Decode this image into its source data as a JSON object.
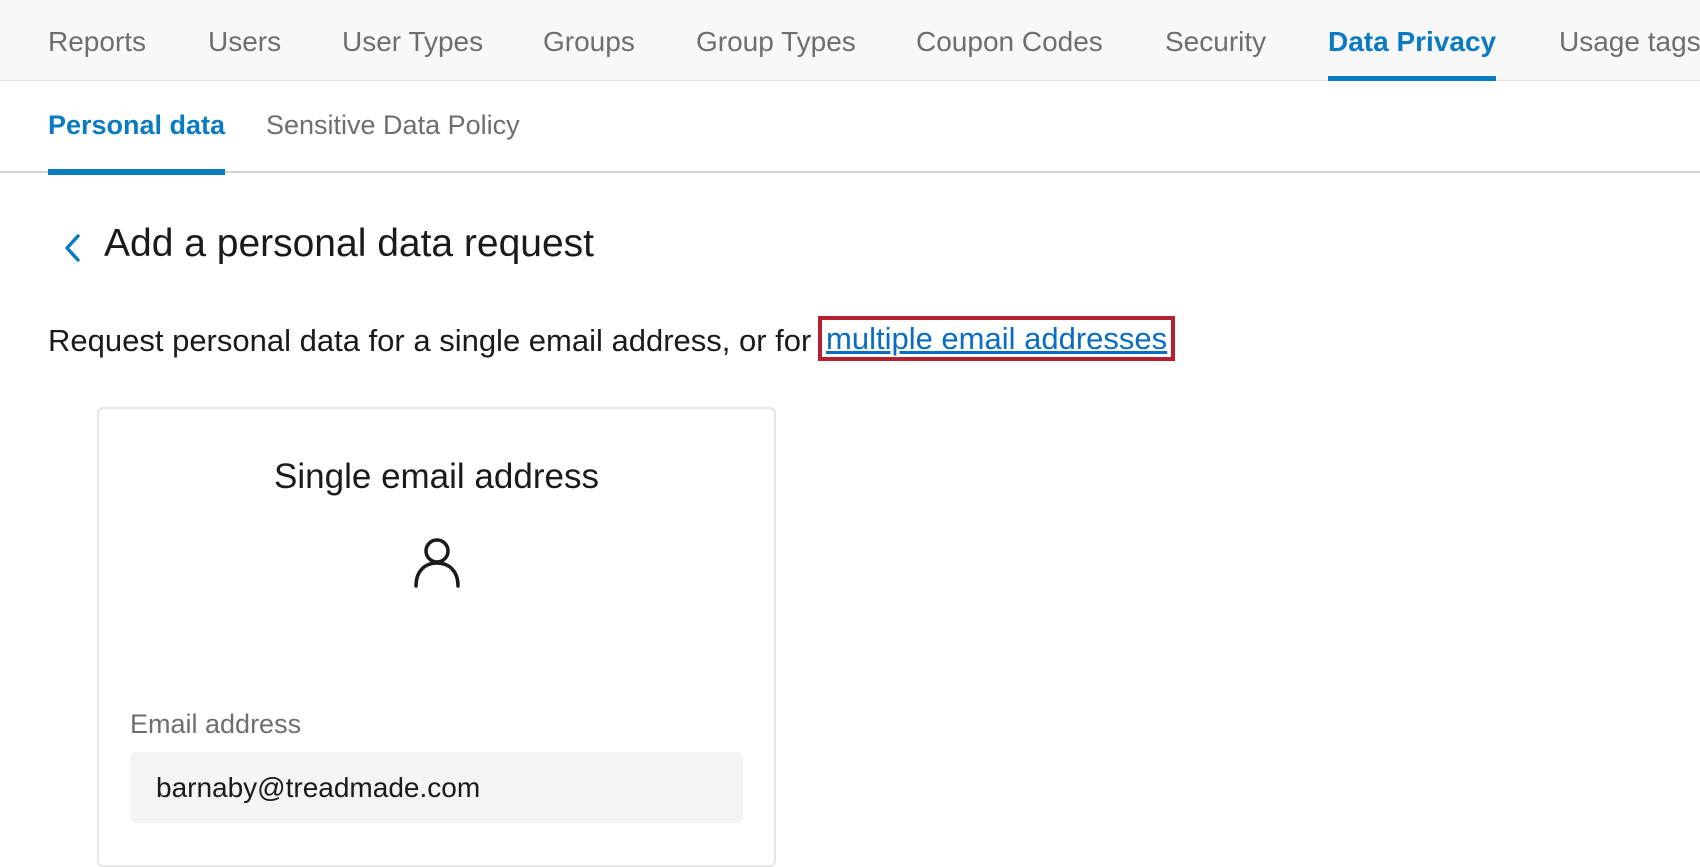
{
  "top_nav": {
    "tabs": [
      {
        "label": "Reports"
      },
      {
        "label": "Users"
      },
      {
        "label": "User Types"
      },
      {
        "label": "Groups"
      },
      {
        "label": "Group Types"
      },
      {
        "label": "Coupon Codes"
      },
      {
        "label": "Security"
      },
      {
        "label": "Data Privacy",
        "active": true
      },
      {
        "label": "Usage tags"
      }
    ]
  },
  "sub_nav": {
    "tabs": [
      {
        "label": "Personal data",
        "active": true
      },
      {
        "label": "Sensitive Data Policy"
      }
    ]
  },
  "page": {
    "title": "Add a personal data request",
    "intro_text": "Request personal data for a single email address, or for",
    "intro_link": "multiple email addresses"
  },
  "card": {
    "title": "Single email address",
    "icon": "person-icon",
    "email_label": "Email address",
    "email_value": "barnaby@treadmade.com"
  },
  "colors": {
    "accent": "#0b7bc1",
    "link": "#0b6cc4",
    "highlight_border": "#b3202f"
  }
}
